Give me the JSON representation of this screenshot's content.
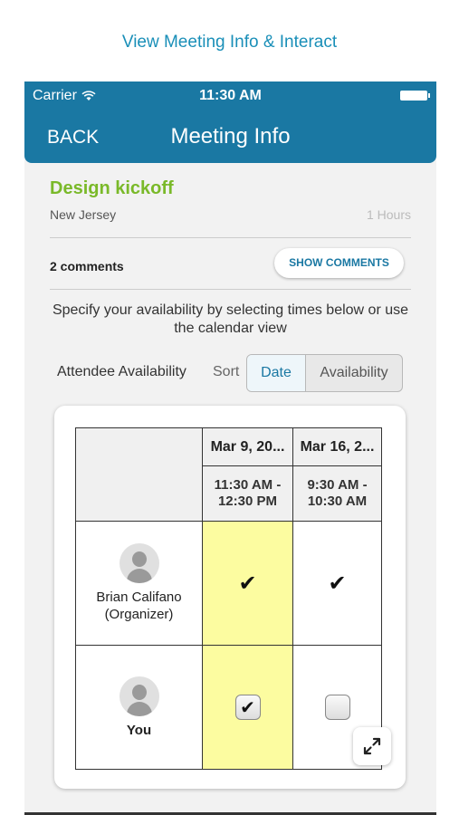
{
  "caption": "View Meeting Info & Interact",
  "status_bar": {
    "carrier": "Carrier",
    "time": "11:30 AM",
    "wifi_icon": "wifi-icon",
    "battery_icon": "battery-icon"
  },
  "nav": {
    "back_label": "BACK",
    "title": "Meeting Info",
    "bar_color": "#1a78a3"
  },
  "meeting": {
    "title": "Design kickoff",
    "title_color": "#7ab929",
    "location": "New Jersey",
    "duration": "1 Hours"
  },
  "comments": {
    "count_label": "2 comments",
    "show_button_label": "SHOW COMMENTS"
  },
  "instructions": "Specify your availability by selecting times below or use the calendar view",
  "availability": {
    "label": "Attendee Availability",
    "sort_label": "Sort",
    "sort_options": [
      "Date",
      "Availability"
    ],
    "selected_sort": "Date"
  },
  "grid": {
    "columns": [
      {
        "date": "Mar 9, 20...",
        "time": "11:30 AM - 12:30 PM",
        "highlighted": true
      },
      {
        "date": "Mar 16, 2...",
        "time": "9:30 AM - 10:30 AM",
        "highlighted": false
      }
    ],
    "attendees": [
      {
        "name_line1": "Brian Califano",
        "name_line2": "(Organizer)",
        "availability": [
          "check",
          "check"
        ]
      },
      {
        "name_line1": "You",
        "name_line2": "",
        "availability": [
          "checkbox-checked",
          "checkbox-unchecked"
        ]
      }
    ],
    "check_glyph": "✔",
    "highlight_color": "#fcfca0"
  },
  "expand_icon": "expand-icon"
}
